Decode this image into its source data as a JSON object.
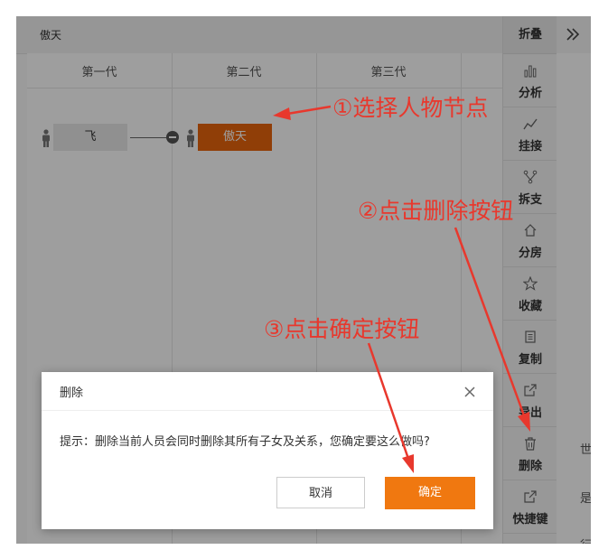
{
  "topbar": {
    "title": "傲天"
  },
  "generations": [
    "第一代",
    "第二代",
    "第三代"
  ],
  "tree": {
    "node_gen1": "飞",
    "node_gen2": "傲天"
  },
  "sidebar": {
    "fold_label": "折叠",
    "expand_glyph": "≫",
    "items": [
      {
        "icon": "bar-chart-icon",
        "label": "分析"
      },
      {
        "icon": "trend-line-icon",
        "label": "挂接"
      },
      {
        "icon": "branch-icon",
        "label": "拆支"
      },
      {
        "icon": "home-icon",
        "label": "分房"
      },
      {
        "icon": "star-icon",
        "label": "收藏"
      },
      {
        "icon": "copy-icon",
        "label": "复制"
      },
      {
        "icon": "export-icon",
        "label": "导出"
      },
      {
        "icon": "trash-icon",
        "label": "删除"
      },
      {
        "icon": "shortcut-icon",
        "label": "快捷键"
      }
    ]
  },
  "right_pane": {
    "texts": [
      "世",
      "是",
      "行"
    ]
  },
  "dialog": {
    "title": "删除",
    "message": "提示：删除当前人员会同时删除其所有子女及关系，您确定要这么做吗?",
    "cancel_label": "取消",
    "ok_label": "确定"
  },
  "annotations": {
    "step1": "①选择人物节点",
    "step2": "②点击删除按钮",
    "step3": "③点击确定按钮"
  },
  "colors": {
    "accent": "#f07810",
    "selected_node": "#e8640c",
    "annotation": "#e8382d"
  }
}
